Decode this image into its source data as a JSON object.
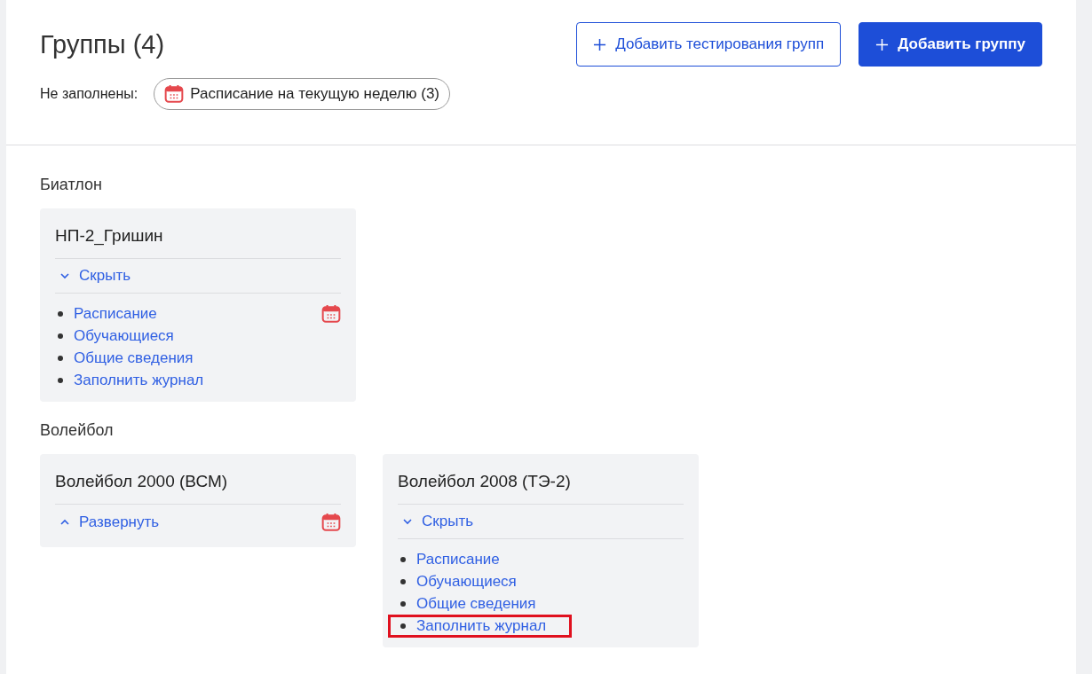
{
  "header": {
    "title": "Группы (4)",
    "buttons": [
      {
        "label": "Добавить тестирования групп",
        "kind": "outline"
      },
      {
        "label": "Добавить группу",
        "kind": "primary"
      }
    ],
    "unfilled": {
      "label": "Не заполнены:",
      "chip": "Расписание на текущую неделю (3)"
    }
  },
  "sections": [
    {
      "title": "Биатлон",
      "groups": [
        {
          "name": "НП-2_Гришин",
          "expanded": true,
          "toggle_label": "Скрыть",
          "schedule_missing": true,
          "links": [
            {
              "label": "Расписание",
              "highlighted": false
            },
            {
              "label": "Обучающиеся",
              "highlighted": false
            },
            {
              "label": "Общие сведения",
              "highlighted": false
            },
            {
              "label": "Заполнить журнал",
              "highlighted": false
            }
          ]
        }
      ]
    },
    {
      "title": "Волейбол",
      "groups": [
        {
          "name": "Волейбол 2000 (ВСМ)",
          "expanded": false,
          "toggle_label": "Развернуть",
          "schedule_missing": true
        },
        {
          "name": "Волейбол 2008 (ТЭ-2)",
          "expanded": true,
          "toggle_label": "Скрыть",
          "schedule_missing": false,
          "links": [
            {
              "label": "Расписание",
              "highlighted": false
            },
            {
              "label": "Обучающиеся",
              "highlighted": false
            },
            {
              "label": "Общие сведения",
              "highlighted": false
            },
            {
              "label": "Заполнить журнал",
              "highlighted": true
            }
          ]
        }
      ]
    }
  ]
}
